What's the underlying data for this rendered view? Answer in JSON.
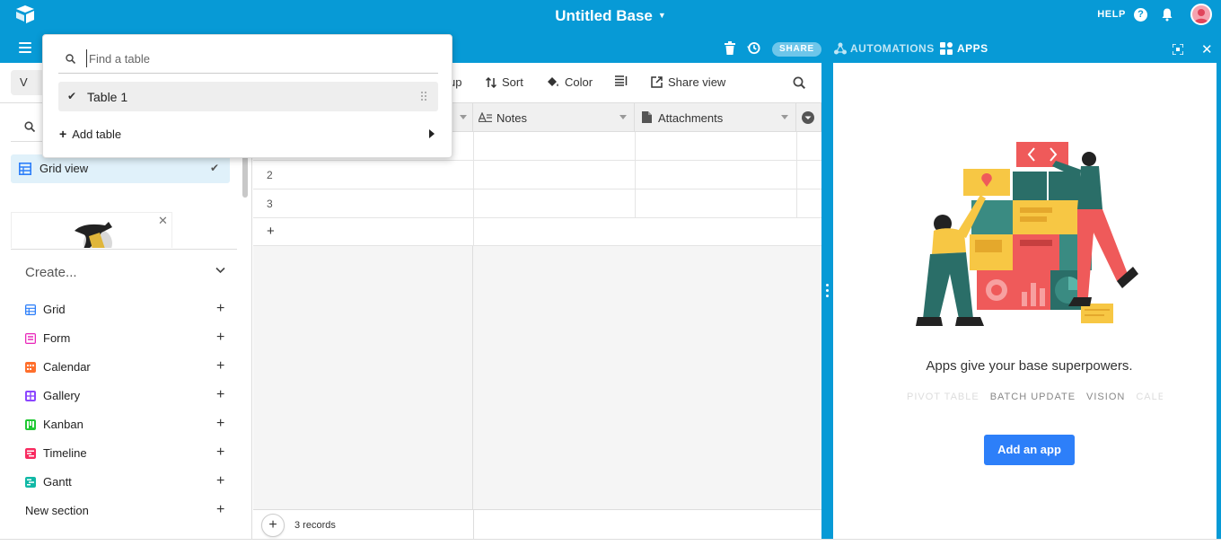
{
  "header": {
    "base_title": "Untitled Base",
    "help_label": "HELP",
    "help_icon_glyph": "?",
    "share_label": "SHARE",
    "automations_label": "AUTOMATIONS",
    "apps_label": "APPS",
    "close_glyph": "✕",
    "brand_color": "#079ad6"
  },
  "sidebar": {
    "views_button_label": "V",
    "grid_view_label": "Grid view",
    "check_glyph": "✔",
    "promo_close_glyph": "✕",
    "create_header": "Create...",
    "create_items": [
      {
        "label": "Grid",
        "icon": "grid-icon",
        "color": "#2d7ff9"
      },
      {
        "label": "Form",
        "icon": "form-icon",
        "color": "#e929ba"
      },
      {
        "label": "Calendar",
        "icon": "calendar-icon",
        "color": "#ff6f2c"
      },
      {
        "label": "Gallery",
        "icon": "gallery-icon",
        "color": "#8b46ff"
      },
      {
        "label": "Kanban",
        "icon": "kanban-icon",
        "color": "#20c933"
      },
      {
        "label": "Timeline",
        "icon": "timeline-icon",
        "color": "#f82b60"
      },
      {
        "label": "Gantt",
        "icon": "gantt-icon",
        "color": "#20d9d2"
      }
    ],
    "new_section_label": "New section",
    "plus_glyph": "+"
  },
  "toolbar": {
    "group_partial": "up",
    "sort_label": "Sort",
    "color_label": "Color",
    "share_view_label": "Share view"
  },
  "grid": {
    "columns": [
      "Notes",
      "Attachments"
    ],
    "row_numbers": [
      "2",
      "3"
    ],
    "add_row_glyph": "+",
    "records_label": "3 records"
  },
  "dropdown": {
    "search_placeholder": "Find a table",
    "table_item_label": "Table 1",
    "check_glyph": "✔",
    "add_table_label": "Add table",
    "plus_glyph": "+"
  },
  "apps_panel": {
    "headline": "Apps give your base superpowers.",
    "tags": [
      "PIVOT TABLE",
      "BATCH UPDATE",
      "VISION",
      "CALE"
    ],
    "add_app_label": "Add an app"
  }
}
